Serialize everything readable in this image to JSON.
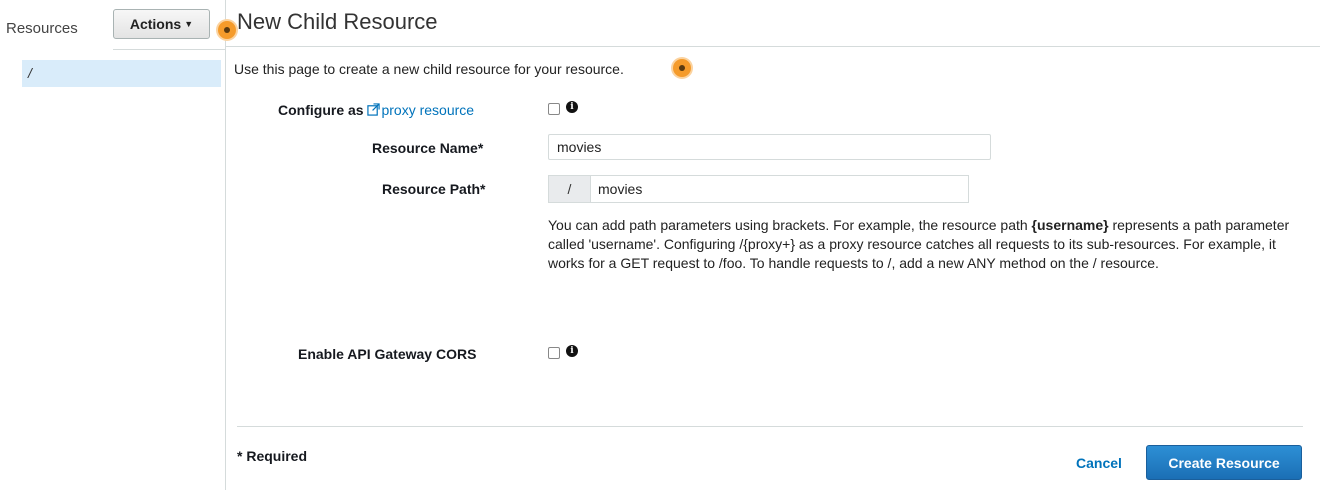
{
  "sidebar": {
    "title": "Resources",
    "actions_label": "Actions",
    "tree_items": [
      {
        "label": "/"
      }
    ]
  },
  "main": {
    "title": "New Child Resource",
    "intro": "Use this page to create a new child resource for your resource.",
    "configure_label_prefix": "Configure as",
    "proxy_link_label": "proxy resource",
    "resource_name_label": "Resource Name*",
    "resource_name_value": "movies",
    "resource_path_label": "Resource Path*",
    "resource_path_prefix": "/",
    "resource_path_value": "movies",
    "help_part1": "You can add path parameters using brackets. For example, the resource path ",
    "help_bold": "{username}",
    "help_part2": " represents a path parameter called 'username'. Configuring /{proxy+} as a proxy resource catches all requests to its sub-resources. For example, it works for a GET request to /foo. To handle requests to /, add a new ANY method on the / resource.",
    "cors_label": "Enable API Gateway CORS",
    "required_note": "* Required",
    "cancel_label": "Cancel",
    "create_label": "Create Resource"
  },
  "colors": {
    "accent": "#0073bb",
    "primary_button": "#1f7bc7",
    "selected_row": "#d9ecfa",
    "hotspot": "#f59b2b"
  },
  "icons": [
    "caret-down-icon",
    "external-link-icon",
    "info-icon",
    "hotspot-marker"
  ]
}
